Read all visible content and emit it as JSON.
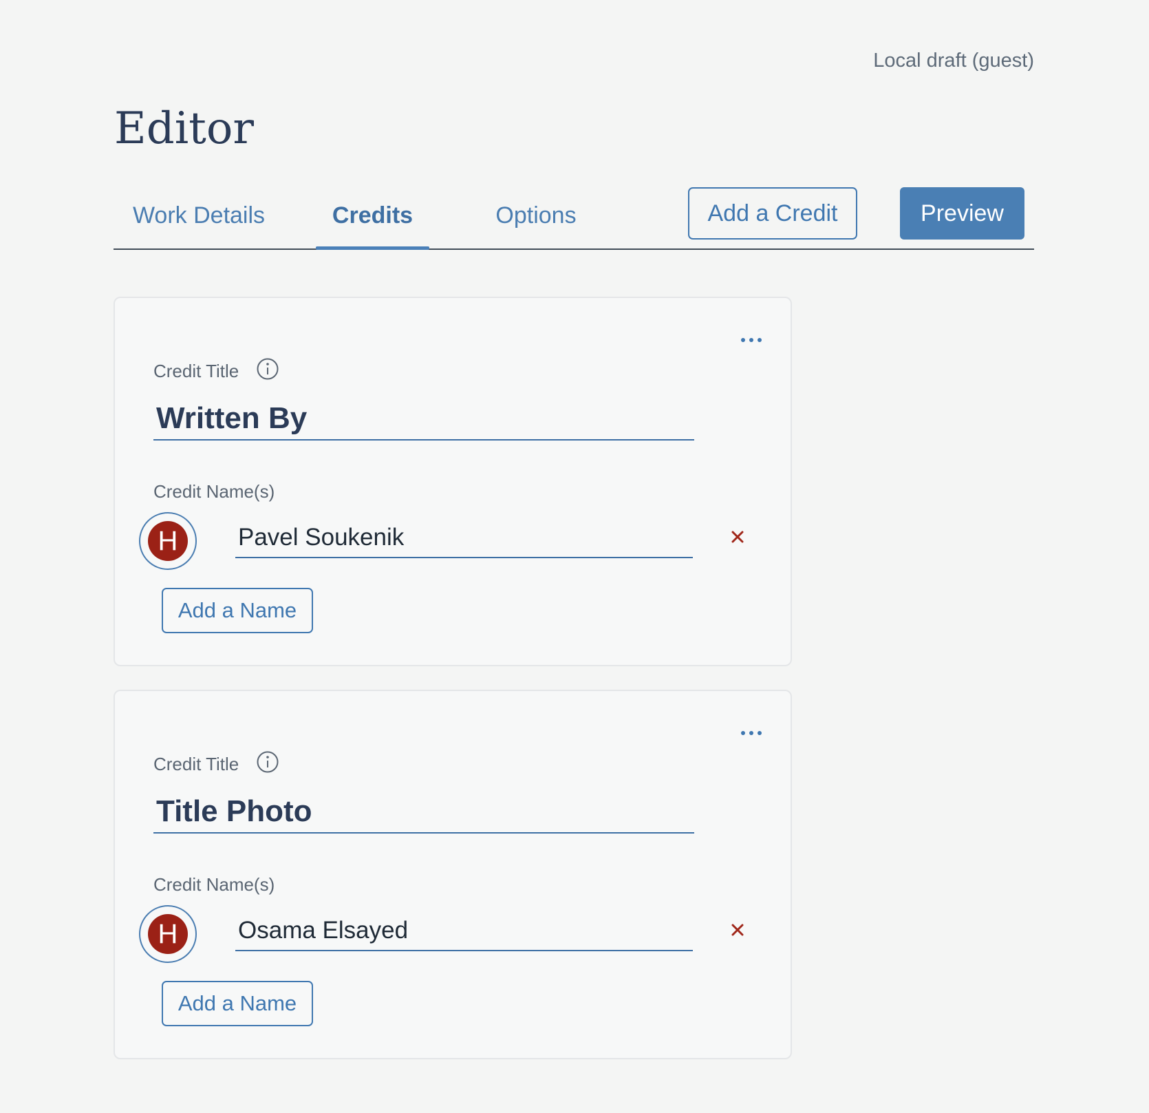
{
  "header": {
    "session_status": "Local draft (guest)",
    "page_title": "Editor"
  },
  "tabs": [
    {
      "label": "Work Details",
      "active": false
    },
    {
      "label": "Credits",
      "active": true
    },
    {
      "label": "Options",
      "active": false
    }
  ],
  "toolbar": {
    "add_credit_label": "Add a Credit",
    "preview_label": "Preview"
  },
  "credits": [
    {
      "title_label": "Credit Title",
      "title_value": "Written By",
      "names_label": "Credit Name(s)",
      "names": [
        {
          "avatar_letter": "H",
          "value": "Pavel Soukenik"
        }
      ],
      "add_name_label": "Add a Name"
    },
    {
      "title_label": "Credit Title",
      "title_value": "Title Photo",
      "names_label": "Credit Name(s)",
      "names": [
        {
          "avatar_letter": "H",
          "value": "Osama Elsayed"
        }
      ],
      "add_name_label": "Add a Name"
    }
  ],
  "icons": {
    "more": "more-horizontal-icon",
    "info": "info-icon",
    "remove": "close-icon"
  },
  "colors": {
    "accent": "#4a7fb4",
    "title_text": "#2b3b57",
    "avatar_bg": "#9b2116",
    "remove": "#a0271a",
    "background": "#f4f5f4"
  }
}
